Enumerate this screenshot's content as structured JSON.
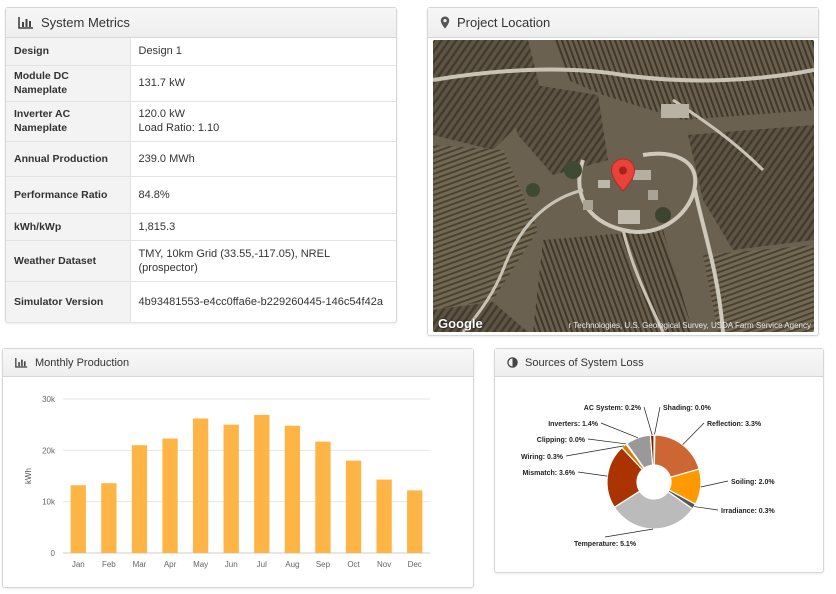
{
  "metrics": {
    "title": "System Metrics",
    "rows": [
      {
        "key": "Design",
        "value": "Design 1"
      },
      {
        "key": "Module DC Nameplate",
        "value": "131.7 kW"
      },
      {
        "key": "Inverter AC Nameplate",
        "value": "120.0 kW",
        "value2": "Load Ratio: 1.10"
      },
      {
        "key": "Annual Production",
        "value": "239.0 MWh"
      },
      {
        "key": "Performance Ratio",
        "value": "84.8%"
      },
      {
        "key": "kWh/kWp",
        "value": "1,815.3"
      },
      {
        "key": "Weather Dataset",
        "value": "TMY, 10km Grid (33.55,-117.05), NREL (prospector)"
      },
      {
        "key": "Simulator Version",
        "value": "4b93481553-e4cc0ffa6e-b229260445-146c54f42a"
      }
    ]
  },
  "location": {
    "title": "Project Location",
    "logo": "Google",
    "credit": "r Technologies, U.S. Geological Survey, USDA Farm Service Agency"
  },
  "monthly": {
    "title": "Monthly Production",
    "bar_color": "#ffb545"
  },
  "loss": {
    "title": "Sources of System Loss"
  },
  "chart_data": [
    {
      "type": "bar",
      "categories": [
        "Jan",
        "Feb",
        "Mar",
        "Apr",
        "May",
        "Jun",
        "Jul",
        "Aug",
        "Sep",
        "Oct",
        "Nov",
        "Dec"
      ],
      "values": [
        13200,
        13600,
        21000,
        22300,
        26200,
        25000,
        26900,
        24800,
        21700,
        18000,
        14300,
        12200
      ],
      "ylabel": "kWh",
      "ylim": [
        0,
        30000
      ],
      "yticks": [
        "0",
        "10k",
        "20k",
        "30k"
      ],
      "grid": true
    },
    {
      "type": "pie",
      "donut": true,
      "slices": [
        {
          "label": "Shading: 0.0%",
          "value": 0.05,
          "color": "#d64b18"
        },
        {
          "label": "Reflection: 3.3%",
          "value": 3.3,
          "color": "#cc6633"
        },
        {
          "label": "Soiling: 2.0%",
          "value": 2.0,
          "color": "#ff9900"
        },
        {
          "label": "Irradiance: 0.3%",
          "value": 0.3,
          "color": "#555555"
        },
        {
          "label": "Temperature: 5.1%",
          "value": 5.1,
          "color": "#bbbbbb"
        },
        {
          "label": "Mismatch: 3.6%",
          "value": 3.6,
          "color": "#aa3300"
        },
        {
          "label": "Wiring: 0.3%",
          "value": 0.3,
          "color": "#dd7700"
        },
        {
          "label": "Clipping: 0.0%",
          "value": 0.05,
          "color": "#ffcc66"
        },
        {
          "label": "Inverters: 1.4%",
          "value": 1.4,
          "color": "#999999"
        },
        {
          "label": "AC System: 0.2%",
          "value": 0.2,
          "color": "#7a2200"
        }
      ]
    }
  ]
}
